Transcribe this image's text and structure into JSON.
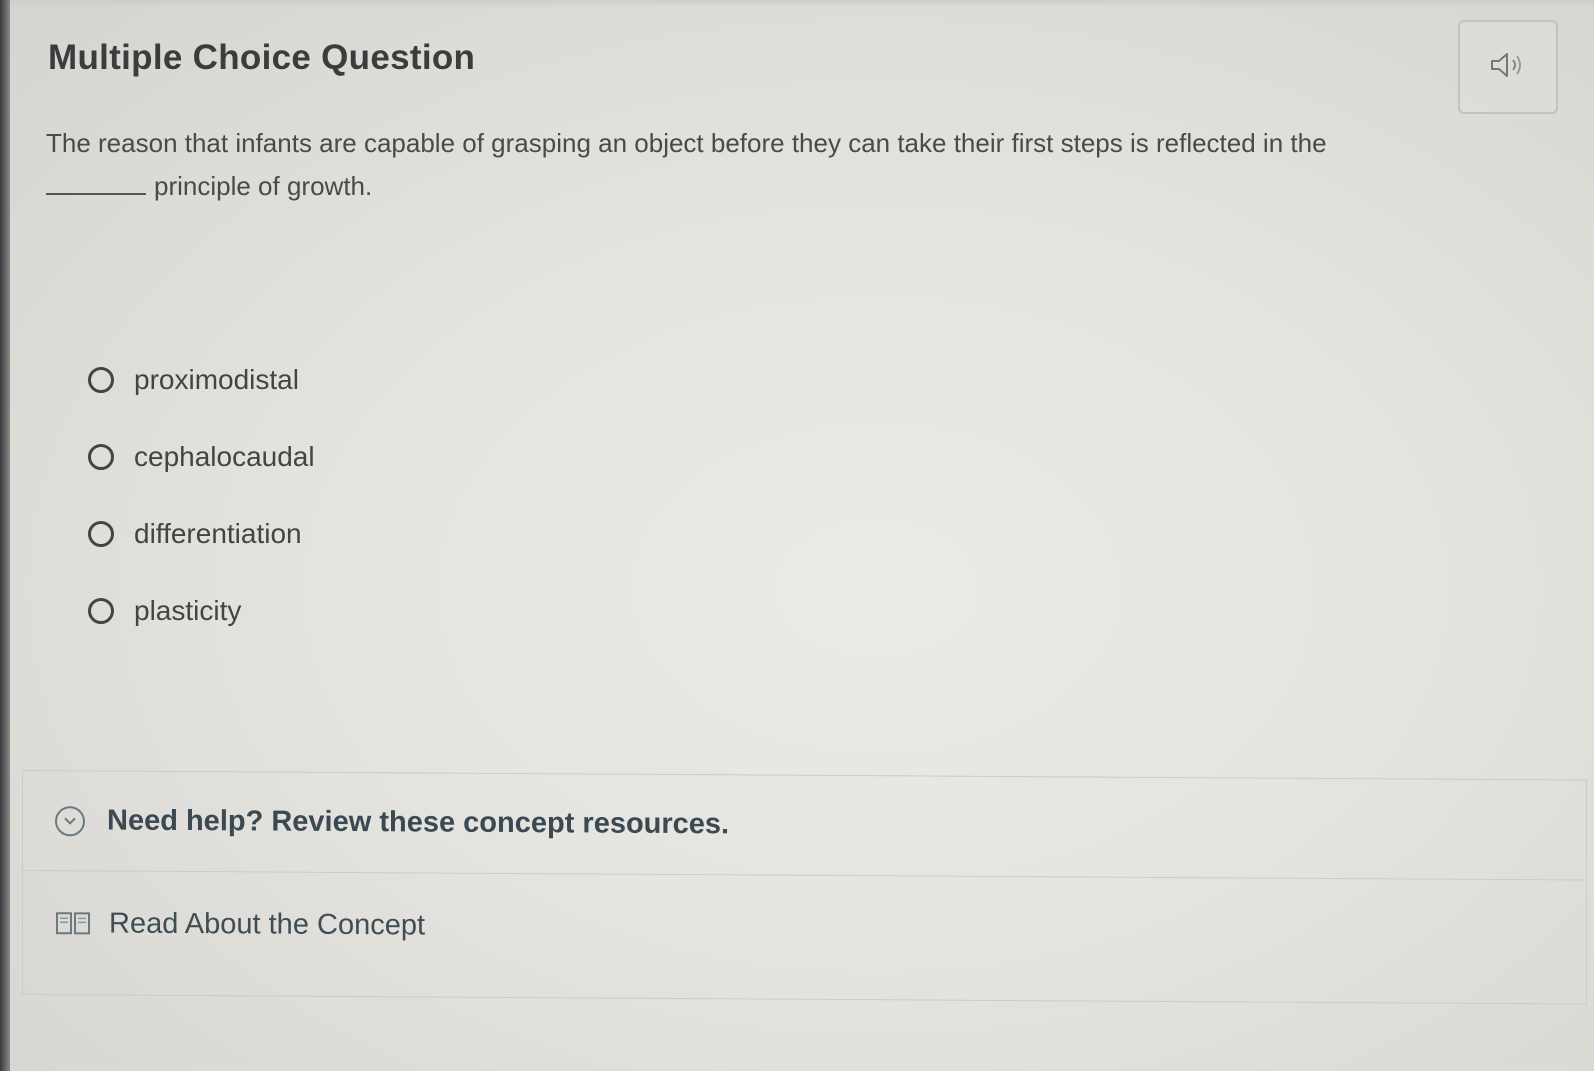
{
  "page": {
    "title": "Multiple Choice Question"
  },
  "audio": {
    "icon": "speaker-icon"
  },
  "question": {
    "text_before_blank": "The reason that infants are capable of grasping an object before they can take their first steps is reflected in the",
    "blank": "______",
    "text_after_blank": "principle of growth."
  },
  "options": [
    {
      "label": "proximodistal",
      "selected": false
    },
    {
      "label": "cephalocaudal",
      "selected": false
    },
    {
      "label": "differentiation",
      "selected": false
    },
    {
      "label": "plasticity",
      "selected": false
    }
  ],
  "help": {
    "title": "Need help? Review these concept resources.",
    "icon": "chevron-down-icon",
    "resources": [
      {
        "label": "Read About the Concept",
        "icon": "book-icon"
      }
    ]
  },
  "colors": {
    "text": "#444444",
    "help_text": "#3b4a52",
    "border": "#cdcbc7"
  }
}
